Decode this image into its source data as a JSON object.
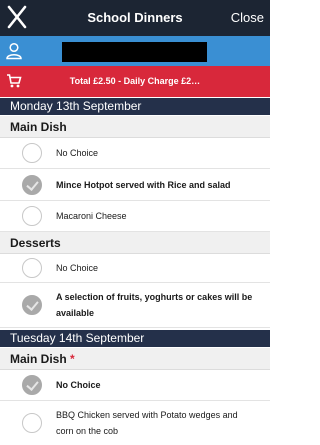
{
  "topbar": {
    "title": "School Dinners",
    "close_label": "Close",
    "icon": "cutlery-icon"
  },
  "userbar": {
    "icon": "user-icon"
  },
  "totalbar": {
    "icon": "cart-icon",
    "text": "Total £2.50 - Daily Charge £2…"
  },
  "days": [
    {
      "label": "Monday 13th September",
      "sections": [
        {
          "title": "Main Dish",
          "required": false,
          "options": [
            {
              "label": "No Choice",
              "selected": false
            },
            {
              "label": "Mince Hotpot served with Rice and salad",
              "selected": true
            },
            {
              "label": "Macaroni Cheese",
              "selected": false
            }
          ]
        },
        {
          "title": "Desserts",
          "required": false,
          "options": [
            {
              "label": "No Choice",
              "selected": false
            },
            {
              "label": "A selection of fruits, yoghurts or cakes will be available",
              "selected": true
            }
          ]
        }
      ]
    },
    {
      "label": "Tuesday 14th September",
      "sections": [
        {
          "title": "Main Dish",
          "required": true,
          "required_mark": "*",
          "options": [
            {
              "label": "No Choice",
              "selected": true
            },
            {
              "label": "BBQ Chicken served with Potato wedges and corn on the cob",
              "selected": false
            }
          ]
        }
      ]
    }
  ],
  "colors": {
    "topbar": "#1c2533",
    "userbar": "#3a8fd3",
    "totalbar": "#d8283b",
    "day_header": "#24304a"
  }
}
